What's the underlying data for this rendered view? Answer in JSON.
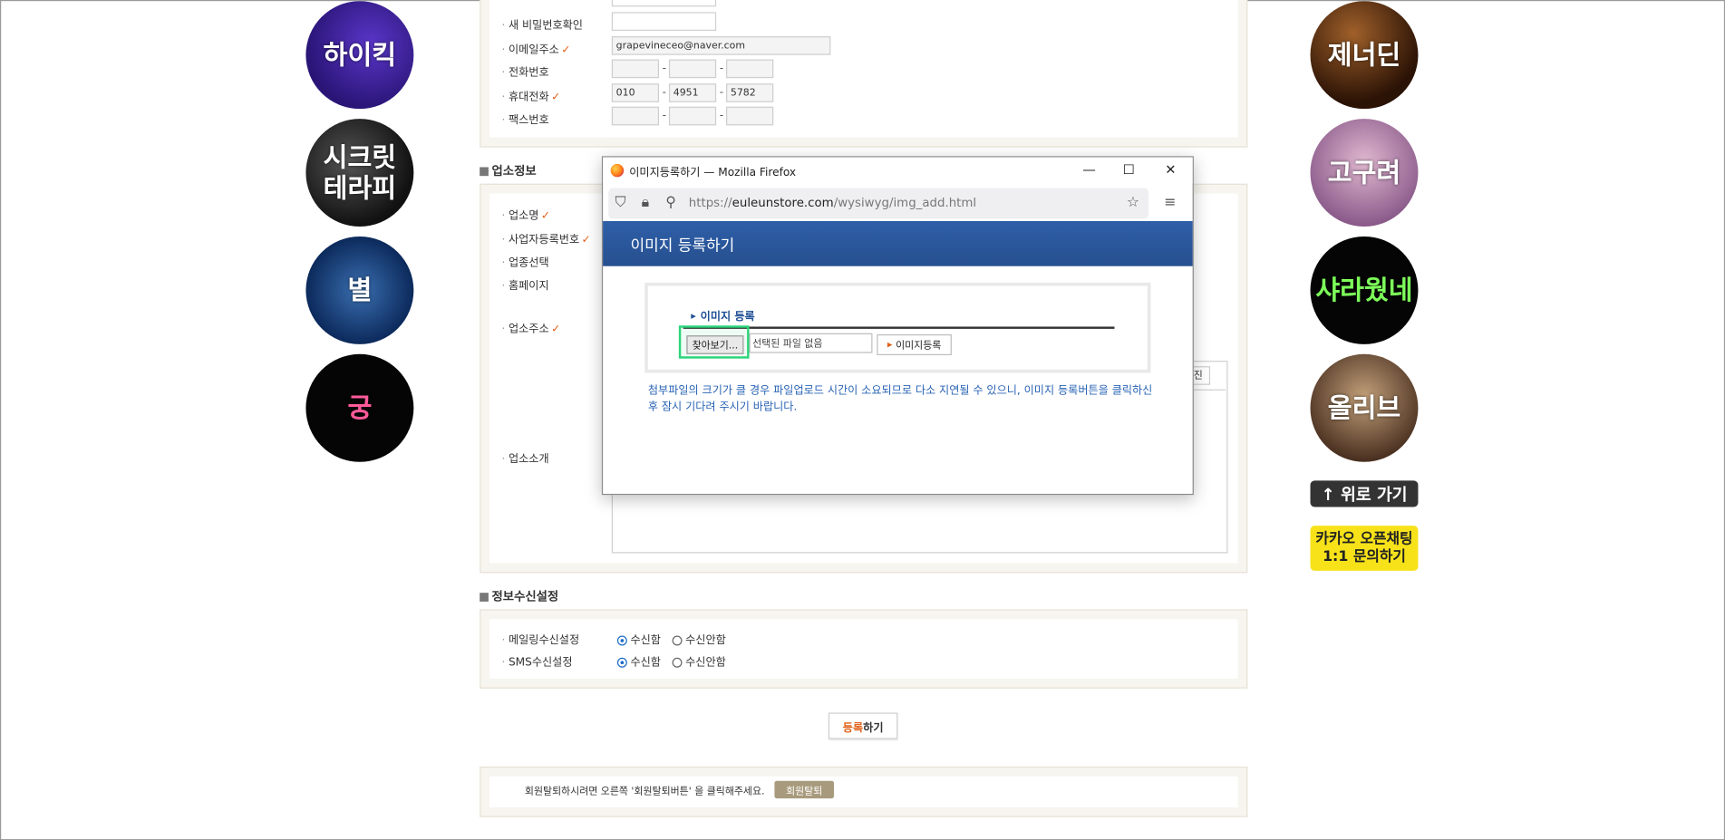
{
  "side_left": [
    {
      "label": "하이킥"
    },
    {
      "label": "시크릿 테라피"
    },
    {
      "label": "별"
    },
    {
      "label": "궁"
    }
  ],
  "side_right": [
    {
      "label": "제너딘"
    },
    {
      "label": "고구려"
    },
    {
      "label": "샤라웠네"
    },
    {
      "label": "올리브"
    }
  ],
  "side_buttons": {
    "top": "↑ 위로 가기",
    "kakao_line1": "카카오 오픈채팅",
    "kakao_line2": "1:1 문의하기"
  },
  "account": {
    "new_pw_confirm_label": "새 비밀번호확인",
    "email_label": "이메일주소",
    "email_value": "grapevineceo@naver.com",
    "phone_label": "전화번호",
    "mobile_label": "휴대전화",
    "mobile": [
      "010",
      "4951",
      "5782"
    ],
    "fax_label": "팩스번호"
  },
  "business": {
    "section_title": "업소정보",
    "name_label": "업소명",
    "reg_no_label": "사업자등록번호",
    "category_label": "업종선택",
    "homepage_label": "홈페이지",
    "address_label": "업소주소",
    "intro_label": "업소소개",
    "editor_btn_tail": "진"
  },
  "notify": {
    "section_title": "정보수신설정",
    "mail_label": "메일링수신설정",
    "sms_label": "SMS수신설정",
    "receive": "수신함",
    "not_receive": "수신안함"
  },
  "submit": {
    "accent": "등록",
    "rest": "하기"
  },
  "withdraw": {
    "text": "회원탈퇴하시려면 오른쪽 '회원탈퇴버튼' 을 클릭해주세요.",
    "button": "회원탈퇴"
  },
  "popup": {
    "window_title": "이미지등록하기 — Mozilla Firefox",
    "url_prefix": "https://",
    "url_domain": "euleunstore.com",
    "url_path": "/wysiwyg/img_add.html",
    "banner_title": "이미지 등록하기",
    "section_title": "이미지 등록",
    "browse_label": "찾아보기...",
    "file_status": "선택된 파일 없음",
    "register_button": "이미지등록",
    "notice": "첨부파일의 크기가 클 경우 파일업로드 시간이 소요되므로 다소 지연될 수 있으니, 이미지 등록버튼을 클릭하신 후 잠시 기다려 주시기 바랍니다."
  },
  "colors": {
    "accent": "#e0621b",
    "banner": "#2f5fa8",
    "highlight": "#2bd47a",
    "kakao": "#f7e21a"
  }
}
